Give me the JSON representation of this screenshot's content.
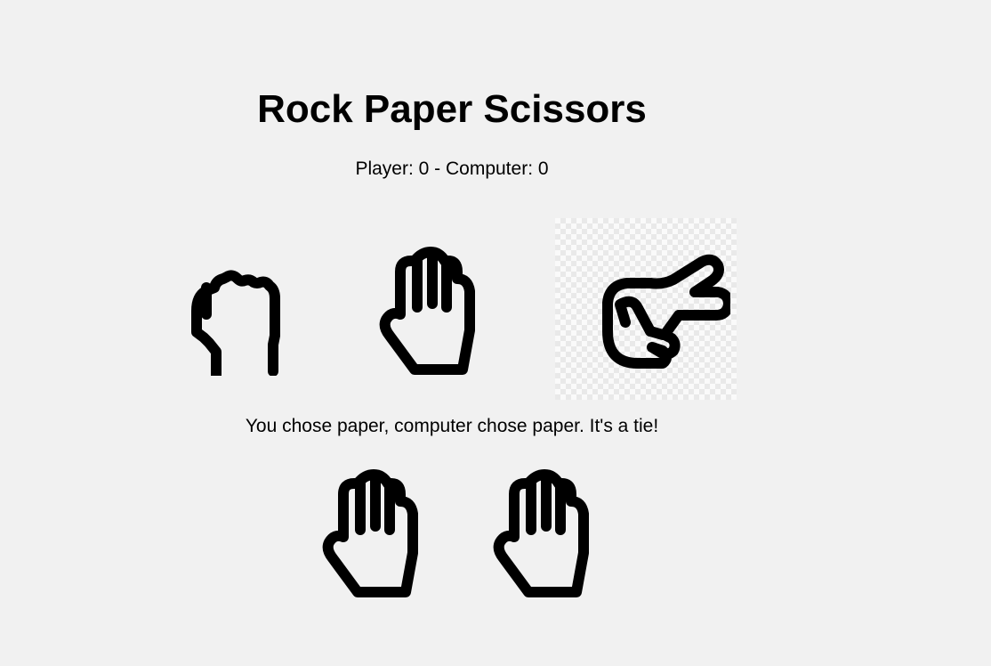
{
  "game": {
    "title": "Rock Paper Scissors",
    "score_text": "Player: 0 - Computer: 0",
    "player_score": 0,
    "computer_score": 0
  },
  "choices": [
    {
      "name": "rock",
      "icon": "fist-icon"
    },
    {
      "name": "paper",
      "icon": "open-hand-icon"
    },
    {
      "name": "scissors",
      "icon": "scissors-hand-icon"
    }
  ],
  "result": {
    "text": "You chose paper, computer chose paper. It's a tie!",
    "player_choice": "paper",
    "computer_choice": "paper",
    "player_icon": "open-hand-icon",
    "computer_icon": "open-hand-icon"
  },
  "colors": {
    "background": "#f1f1f1",
    "icon_stroke": "#000000"
  }
}
